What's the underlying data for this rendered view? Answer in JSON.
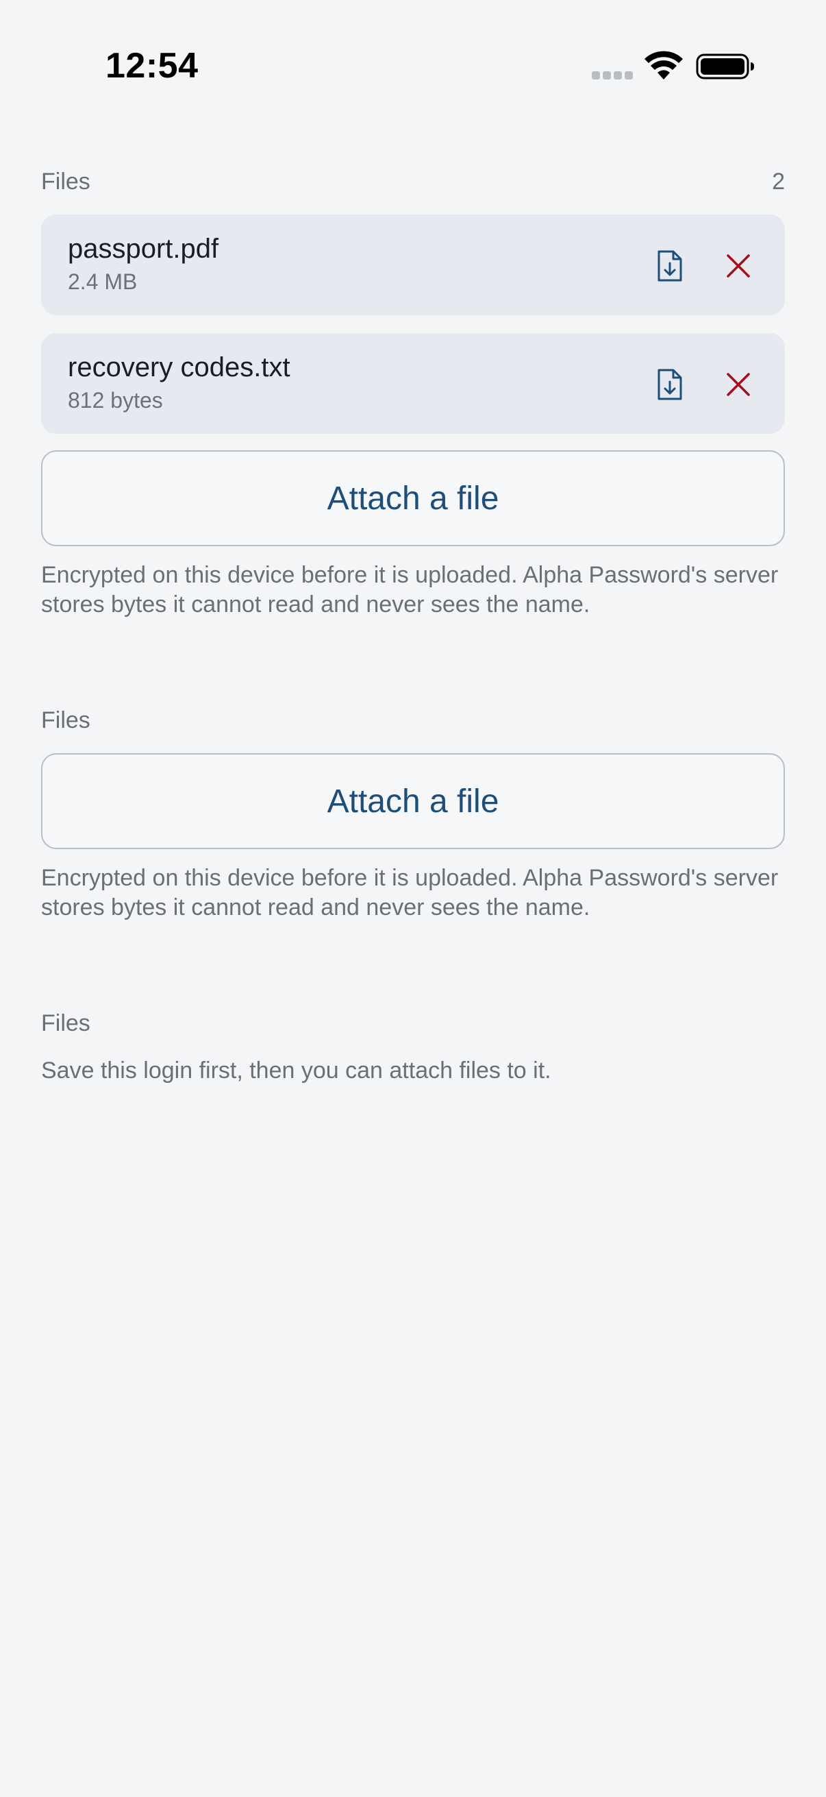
{
  "status_bar": {
    "time": "12:54"
  },
  "sections": [
    {
      "label": "Files",
      "count": "2",
      "files": [
        {
          "name": "passport.pdf",
          "size": "2.4 MB"
        },
        {
          "name": "recovery codes.txt",
          "size": "812 bytes"
        }
      ],
      "attach_label": "Attach a file",
      "help": "Encrypted on this device before it is uploaded. Alpha Password's server stores bytes it cannot read and never sees the name."
    },
    {
      "label": "Files",
      "attach_label": "Attach a file",
      "help": "Encrypted on this device before it is uploaded. Alpha Password's server stores bytes it cannot read and never sees the name."
    },
    {
      "label": "Files",
      "help": "Save this login first, then you can attach files to it."
    }
  ],
  "icons": {
    "download": "file-download-icon",
    "remove": "close-icon",
    "signal": "cellular-signal-icon",
    "wifi": "wifi-icon",
    "battery": "battery-icon"
  },
  "colors": {
    "background": "#f3f5f7",
    "card": "#e6e9f0",
    "accent": "#1e4e78",
    "remove": "#a3101c",
    "secondary_text": "#6a6f77"
  }
}
